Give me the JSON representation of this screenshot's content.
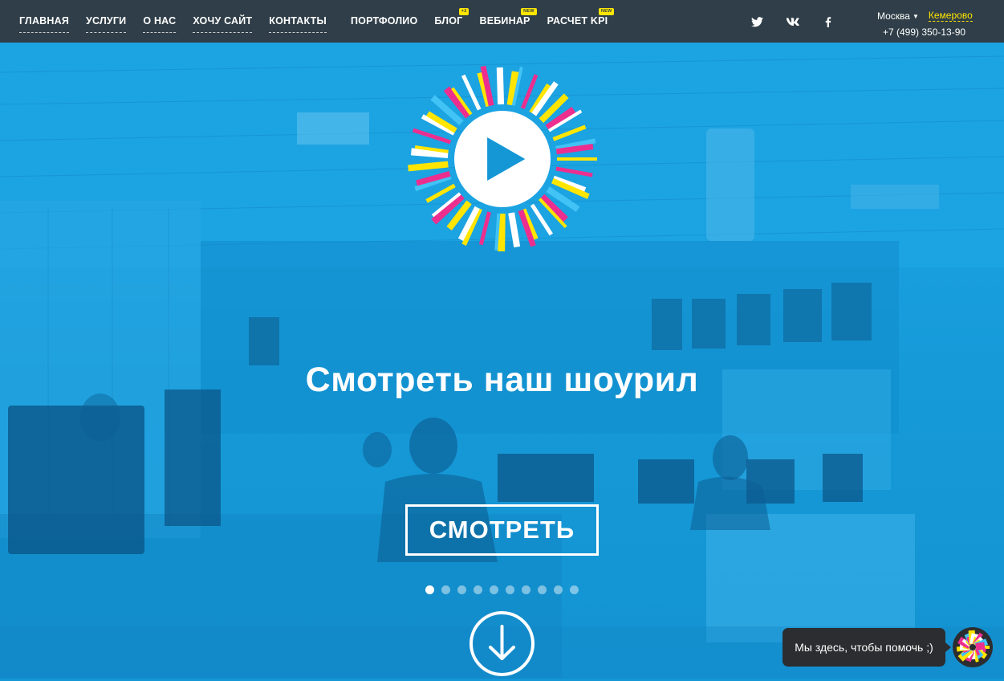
{
  "nav": {
    "left_items": [
      {
        "label": "ГЛАВНАЯ"
      },
      {
        "label": "УСЛУГИ"
      },
      {
        "label": "О НАС"
      },
      {
        "label": "ХОЧУ САЙТ"
      },
      {
        "label": "КОНТАКТЫ"
      }
    ],
    "mid_items": [
      {
        "label": "ПОРТФОЛИО",
        "badge": ""
      },
      {
        "label": "БЛОГ",
        "badge": "+2"
      },
      {
        "label": "ВЕБИНАР",
        "badge": "NEW"
      },
      {
        "label": "РАСЧЕТ KPI",
        "badge": "NEW"
      }
    ]
  },
  "social": {
    "icons": [
      "twitter-icon",
      "vk-icon",
      "facebook-icon"
    ]
  },
  "city": {
    "current": "Москва",
    "alternate": "Кемерово",
    "phone": "+7 (499) 350-13-90"
  },
  "hero": {
    "title": "Смотреть наш шоурил",
    "button_label": "СМОТРЕТЬ",
    "slides_count": 10,
    "active_slide": 1
  },
  "chat": {
    "message": "Мы здесь, чтобы помочь ;)"
  },
  "colors": {
    "topbar": "#2f3e48",
    "hero_blue": "#1597d6",
    "accent_yellow": "#ffe500",
    "accent_pink": "#ec2f8f"
  }
}
